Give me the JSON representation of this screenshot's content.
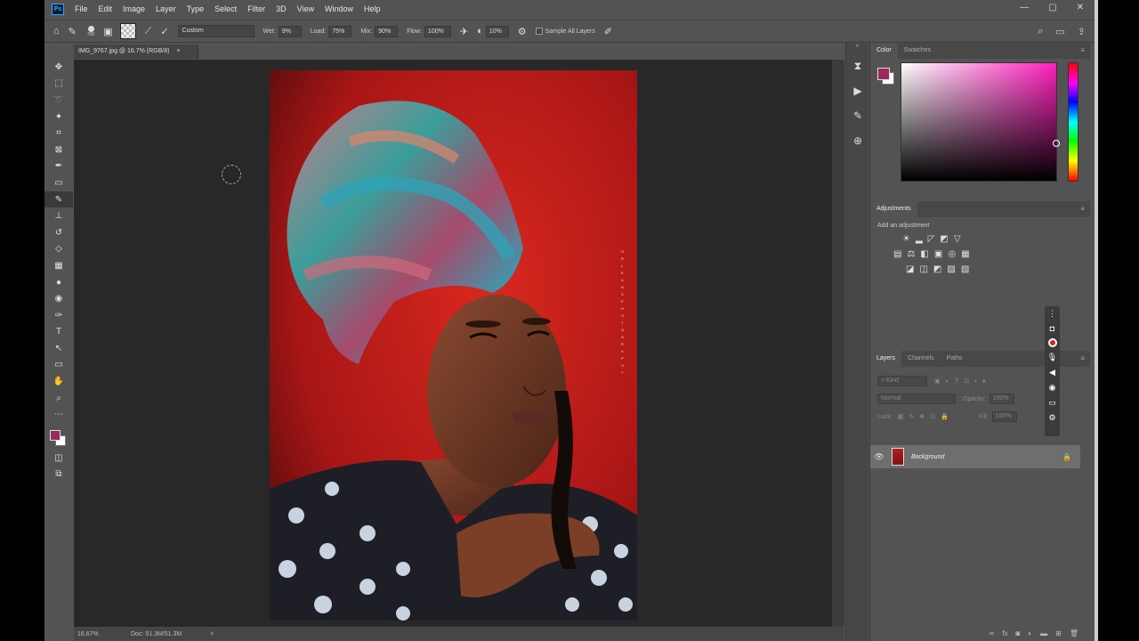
{
  "menu": {
    "logo": "Ps",
    "items": [
      "File",
      "Edit",
      "Image",
      "Layer",
      "Type",
      "Select",
      "Filter",
      "3D",
      "View",
      "Window",
      "Help"
    ]
  },
  "window_controls": {
    "minimize": "—",
    "maximize": "▢",
    "close": "✕"
  },
  "options_bar": {
    "brush_size": "700",
    "preset": "Custom",
    "wet_label": "Wet:",
    "wet_value": "9%",
    "load_label": "Load:",
    "load_value": "75%",
    "mix_label": "Mix:",
    "mix_value": "90%",
    "flow_label": "Flow:",
    "flow_value": "100%",
    "smoothing_value": "10%",
    "sample_all_layers": "Sample All Layers"
  },
  "document": {
    "tab_title": "IMG_9767.jpg @ 16.7% (RGB/8)",
    "tab_close": "×",
    "zoom": "16.67%",
    "doc_size": "Doc: 51.3M/51.3M",
    "status_arrow": ">",
    "watermark": "ORLEANS PHOTOGRAPHY"
  },
  "color_panel": {
    "tabs": [
      "Color",
      "Swatches"
    ],
    "foreground": "#9b2a61",
    "background": "#ffffff"
  },
  "adjustments_panel": {
    "tabs": [
      "Adjustments"
    ],
    "hint": "Add an adjustment"
  },
  "layers_panel": {
    "tabs": [
      "Layers",
      "Channels",
      "Paths"
    ],
    "kind_placeholder": "Kind",
    "blend_mode": "Normal",
    "opacity_label": "Opacity:",
    "opacity_value": "100%",
    "lock_label": "Lock:",
    "fill_label": "Fill:",
    "fill_value": "100%",
    "layer_name": "Background"
  },
  "panel_menu": "≡",
  "collapse_arrows": "»",
  "colors": {
    "accent": "#9b2a61",
    "photo_background": "#b51d1d"
  }
}
